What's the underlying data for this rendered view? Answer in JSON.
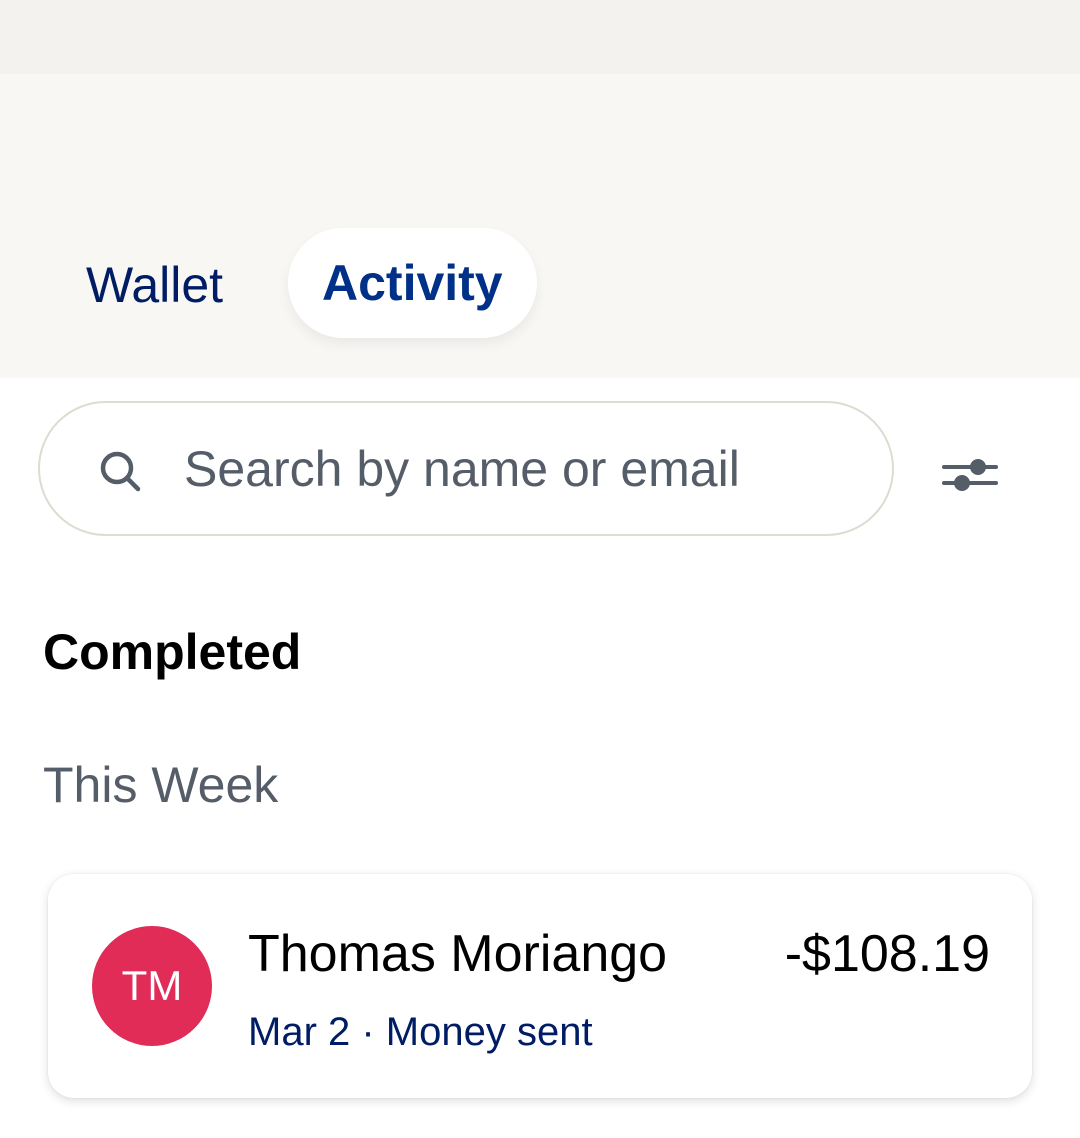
{
  "tabs": {
    "wallet_label": "Wallet",
    "activity_label": "Activity",
    "selected": "Activity"
  },
  "search": {
    "placeholder": "Search by name or email",
    "value": ""
  },
  "filter": {
    "icon": "sliders-icon"
  },
  "sections": {
    "completed_title": "Completed",
    "group_title": "This Week"
  },
  "transactions": [
    {
      "initials": "TM",
      "name": "Thomas Moriango",
      "subtitle": "Mar 2 · Money sent",
      "amount": "-$108.19",
      "avatar_color": "#e02c57"
    }
  ],
  "colors": {
    "brand_navy": "#001c64",
    "active_tab": "#003087",
    "header_bg": "#f8f7f4"
  }
}
